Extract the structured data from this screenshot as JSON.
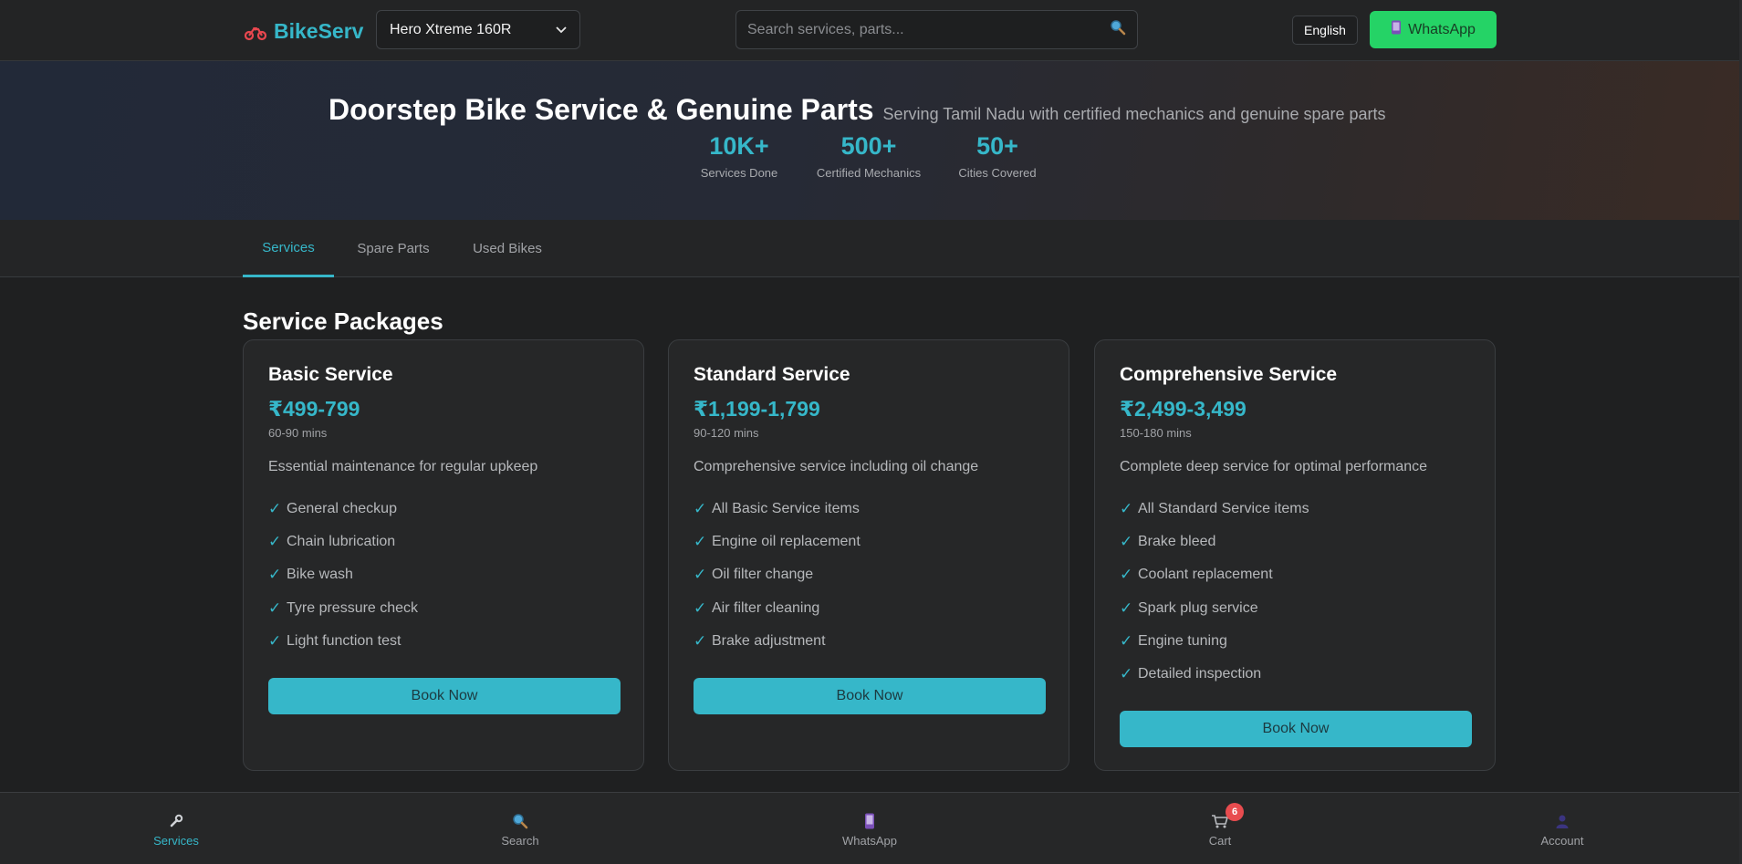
{
  "header": {
    "brand": "BikeServ",
    "bike_selected": "Hero Xtreme 160R",
    "search_placeholder": "Search services, parts...",
    "language": "English",
    "whatsapp_label": "WhatsApp"
  },
  "hero": {
    "title": "Doorstep Bike Service & Genuine Parts",
    "subtitle": "Serving Tamil Nadu with certified mechanics and genuine spare parts",
    "stats": [
      {
        "value": "10K+",
        "label": "Services Done"
      },
      {
        "value": "500+",
        "label": "Certified Mechanics"
      },
      {
        "value": "50+",
        "label": "Cities Covered"
      }
    ]
  },
  "tabs": [
    {
      "label": "Services",
      "active": true
    },
    {
      "label": "Spare Parts",
      "active": false
    },
    {
      "label": "Used Bikes",
      "active": false
    }
  ],
  "section_title": "Service Packages",
  "packages": [
    {
      "name": "Basic Service",
      "price": "₹499-799",
      "duration": "60-90 mins",
      "description": "Essential maintenance for regular upkeep",
      "features": [
        "General checkup",
        "Chain lubrication",
        "Bike wash",
        "Tyre pressure check",
        "Light function test"
      ],
      "cta": "Book Now"
    },
    {
      "name": "Standard Service",
      "price": "₹1,199-1,799",
      "duration": "90-120 mins",
      "description": "Comprehensive service including oil change",
      "features": [
        "All Basic Service items",
        "Engine oil replacement",
        "Oil filter change",
        "Air filter cleaning",
        "Brake adjustment"
      ],
      "cta": "Book Now"
    },
    {
      "name": "Comprehensive Service",
      "price": "₹2,499-3,499",
      "duration": "150-180 mins",
      "description": "Complete deep service for optimal performance",
      "features": [
        "All Standard Service items",
        "Brake bleed",
        "Coolant replacement",
        "Spark plug service",
        "Engine tuning",
        "Detailed inspection"
      ],
      "cta": "Book Now"
    }
  ],
  "bottom_nav": {
    "items": [
      {
        "label": "Services",
        "icon": "wrench-icon",
        "active": true
      },
      {
        "label": "Search",
        "icon": "search-icon",
        "active": false
      },
      {
        "label": "WhatsApp",
        "icon": "phone-icon",
        "active": false
      },
      {
        "label": "Cart",
        "icon": "cart-icon",
        "active": false
      },
      {
        "label": "Account",
        "icon": "user-icon",
        "active": false
      }
    ],
    "cart_count": "6"
  },
  "colors": {
    "accent": "#36b7c9",
    "whatsapp": "#25d366",
    "badge": "#e84c4f",
    "background": "#1f2021"
  }
}
